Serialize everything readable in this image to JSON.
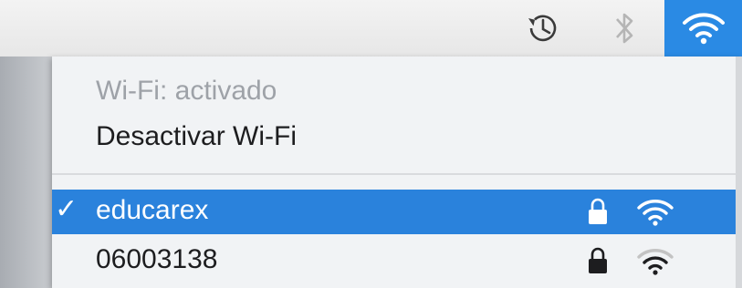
{
  "menubar": {
    "icons": [
      "time-machine-icon",
      "bluetooth-icon",
      "wifi-icon"
    ],
    "wifi_highlight_color": "#2a8ae4"
  },
  "menu": {
    "status_label": "Wi-Fi: activado",
    "toggle_label": "Desactivar Wi-Fi",
    "networks": [
      {
        "name": "educarex",
        "connected": true,
        "locked": true,
        "signal": "full"
      },
      {
        "name": "06003138",
        "connected": false,
        "locked": true,
        "signal": "partial"
      }
    ],
    "checkmark": "✓",
    "selection_color": "#2a82dc"
  }
}
